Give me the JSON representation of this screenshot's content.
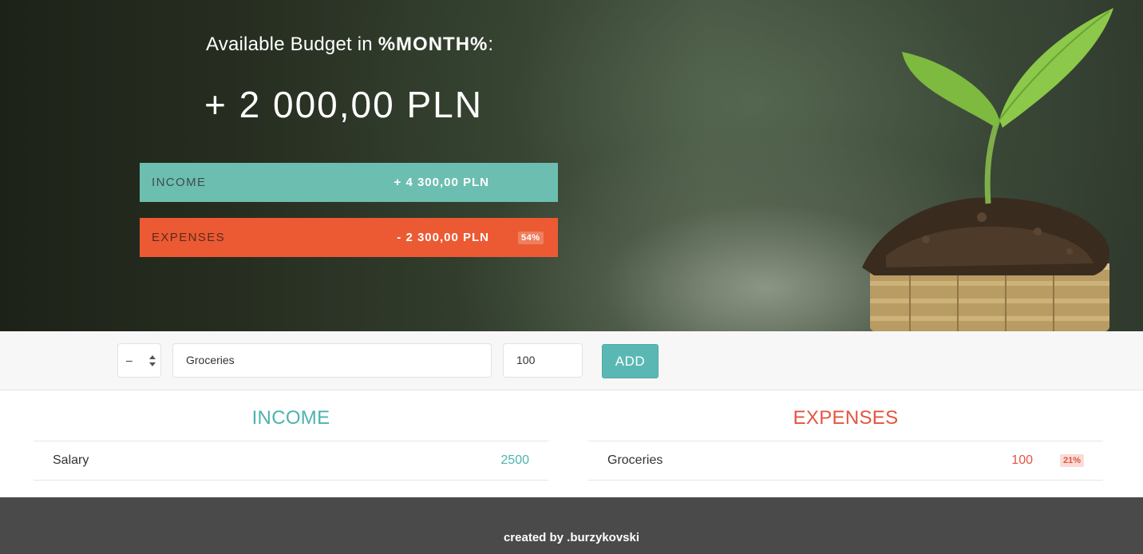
{
  "budget": {
    "title_prefix": "Available Budget in ",
    "title_month": "%MONTH%",
    "title_suffix": ":",
    "value": "+ 2 000,00 PLN"
  },
  "summary": {
    "income": {
      "label": "INCOME",
      "amount": "+ 4 300,00 PLN"
    },
    "expenses": {
      "label": "EXPENSES",
      "amount": "- 2 300,00 PLN",
      "percentage": "54%"
    }
  },
  "add_form": {
    "type_value": "–",
    "description_value": "Groceries",
    "value_value": "100",
    "add_label": "ADD"
  },
  "income_list": {
    "title": "INCOME",
    "items": [
      {
        "description": "Salary",
        "value": "2500"
      }
    ]
  },
  "expenses_list": {
    "title": "EXPENSES",
    "items": [
      {
        "description": "Groceries",
        "value": "100",
        "percentage": "21%"
      }
    ]
  },
  "footer": {
    "text": "created by .burzykovski"
  },
  "colors": {
    "income_accent": "#6cbeb0",
    "expenses_accent": "#eb5a33",
    "button": "#5ab8b4",
    "footer_bg": "#4a4a4a"
  }
}
